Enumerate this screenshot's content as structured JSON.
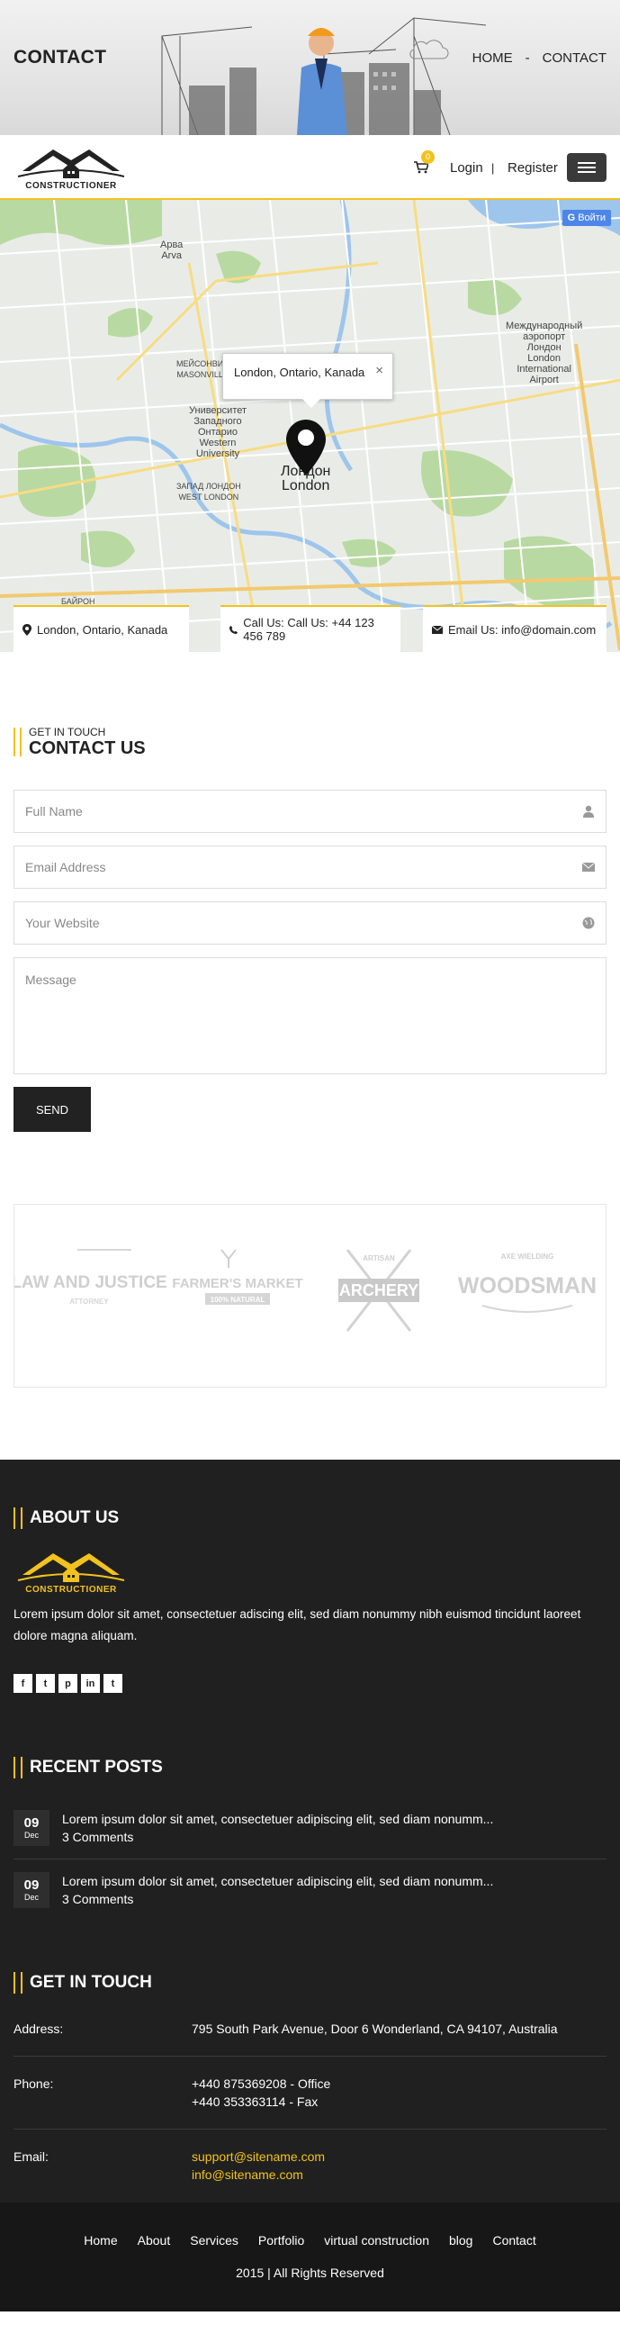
{
  "banner": {
    "title": "CONTACT",
    "breadcrumbs": [
      "HOME",
      "-",
      "CONTACT"
    ]
  },
  "header": {
    "logo_text": "CONSTRUCTIONER",
    "cart_count": "0",
    "login_label": "Login",
    "separator": "|",
    "register_label": "Register"
  },
  "map": {
    "sign_in_label": "Войти",
    "popup_text": "London, Ontario, Kanada",
    "popup_close": "×",
    "labels": {
      "arva": "Арва\nArva",
      "univ": "Университет\nЗападного\nОнтарио\nWestern\nUniversity",
      "city": "Лондон\nLondon",
      "airport": "Международный\nаэропорт\nЛондон\nLondon\nInternational\nAirport",
      "masonville": "МЕЙСОНВИЛ\nMASONVILLE",
      "westlondon": "ЗАПАД ЛОНДОН\nWEST LONDON",
      "byron": "БАЙРОН"
    }
  },
  "info_bar": {
    "location": "London, Ontario, Kanada",
    "phone": "Call Us: Call Us: +44 123 456 789",
    "email": "Email Us: info@domain.com"
  },
  "contact": {
    "kicker": "GET IN TOUCH",
    "title": "CONTACT US",
    "fields": {
      "name_placeholder": "Full Name",
      "email_placeholder": "Email Address",
      "website_placeholder": "Your Website",
      "message_placeholder": "Message"
    },
    "send_label": "SEND"
  },
  "clients": {
    "logos": [
      {
        "top": "LAW AND JUSTICE",
        "small": "ATTORNEY"
      },
      {
        "top": "FARMER'S MARKET",
        "small": "100% NATURAL"
      },
      {
        "top": "ARCHERY",
        "small": "ARTISAN"
      },
      {
        "top": "WOODSMAN",
        "small": "AXE WIELDING"
      }
    ]
  },
  "footer": {
    "about_title": "ABOUT US",
    "logo_text": "CONSTRUCTIONER",
    "about_text": "Lorem ipsum dolor sit amet, consectetuer adiscing elit, sed diam nonummy nibh euismod tincidunt laoreet dolore magna aliquam.",
    "socials": [
      "f",
      "t",
      "p",
      "in",
      "t"
    ],
    "recent_title": "RECENT POSTS",
    "posts": [
      {
        "day": "09",
        "month": "Dec",
        "title": "Lorem ipsum dolor sit amet, consectetuer adipiscing elit, sed diam nonumm...",
        "comments": "3 Comments"
      },
      {
        "day": "09",
        "month": "Dec",
        "title": "Lorem ipsum dolor sit amet, consectetuer adipiscing elit, sed diam nonumm...",
        "comments": "3 Comments"
      }
    ],
    "git_title": "GET IN TOUCH",
    "address_label": "Address:",
    "address_value": "795 South Park Avenue, Door 6 Wonderland, CA 94107, Australia",
    "phone_label": "Phone:",
    "phone_office": "+440 875369208 - Office",
    "phone_fax": "+440 353363114 - Fax",
    "email_label": "Email:",
    "email_support": "support@sitename.com",
    "email_info": "info@sitename.com"
  },
  "bottom": {
    "nav": [
      "Home",
      "About",
      "Services",
      "Portfolio",
      "virtual construction",
      "blog",
      "Contact"
    ],
    "copyright": "2015 | All Rights Reserved"
  },
  "colors": {
    "accent": "#f2c21e",
    "dark": "#202020",
    "darker": "#171717"
  }
}
